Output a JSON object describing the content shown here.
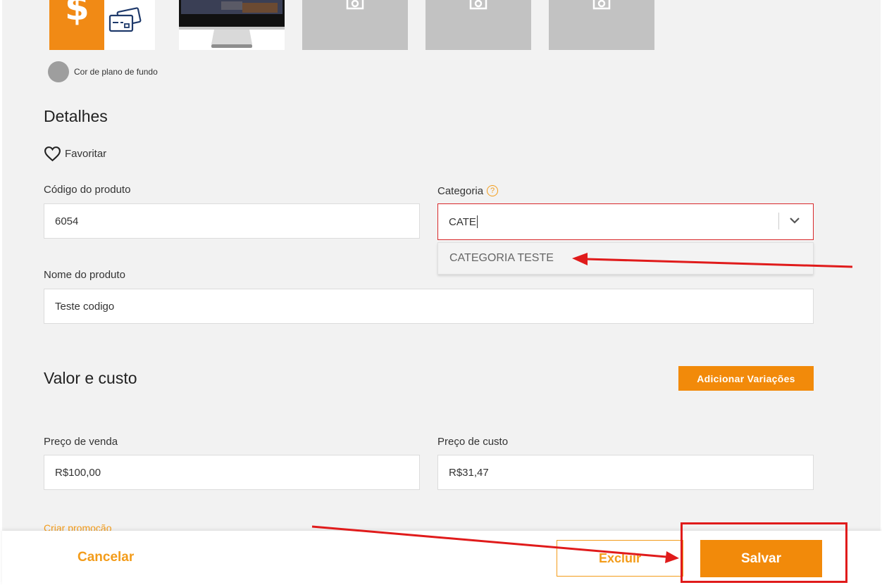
{
  "background_color": {
    "label": "Cor de plano de fundo",
    "swatch_color": "#9e9e9e"
  },
  "details": {
    "title": "Detalhes",
    "favorite_label": "Favoritar",
    "product_code": {
      "label": "Código do produto",
      "value": "6054"
    },
    "category": {
      "label": "Categoria",
      "help_symbol": "?",
      "typed_value": "CATE",
      "options": [
        "CATEGORIA TESTE"
      ]
    },
    "product_name": {
      "label": "Nome do produto",
      "value": "Teste codigo"
    }
  },
  "pricing": {
    "title": "Valor e custo",
    "add_variations_label": "Adicionar Variações",
    "sale_price": {
      "label": "Preço de venda",
      "value": "R$100,00"
    },
    "cost_price": {
      "label": "Preço de custo",
      "value": "R$31,47"
    },
    "create_promo_label": "Criar promoção"
  },
  "footer": {
    "cancel_label": "Cancelar",
    "delete_label": "Excluir",
    "save_label": "Salvar"
  },
  "colors": {
    "accent": "#f28a0a",
    "annotation_red": "#e01b1b"
  },
  "icons": [
    "dollar-icon",
    "credit-card-icon",
    "camera-icon",
    "heart-icon",
    "help-icon",
    "chevron-down-icon"
  ]
}
